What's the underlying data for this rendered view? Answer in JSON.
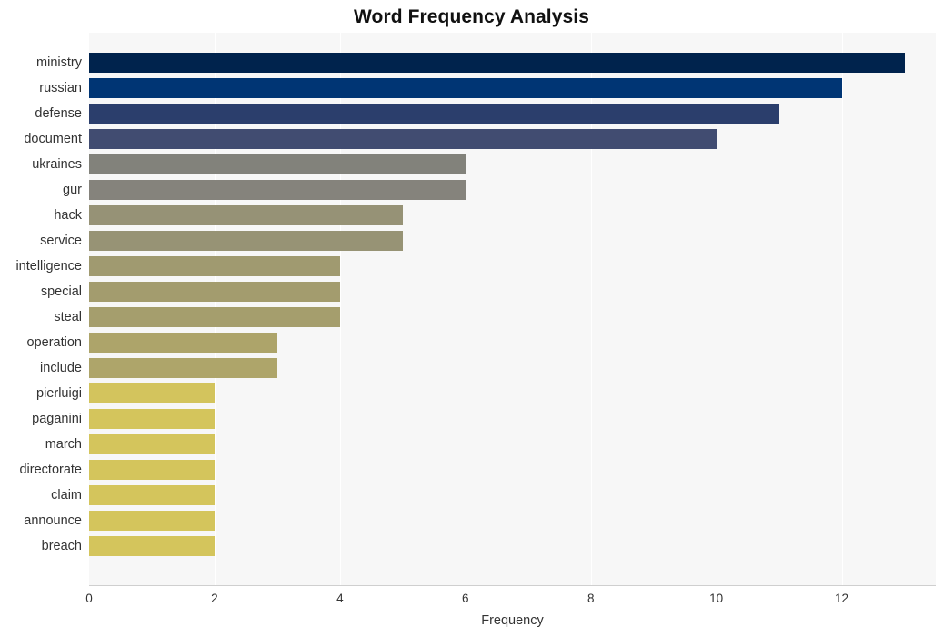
{
  "chart_data": {
    "type": "bar",
    "orientation": "horizontal",
    "title": "Word Frequency Analysis",
    "xlabel": "Frequency",
    "ylabel": "",
    "xlim": [
      0,
      13.5
    ],
    "xticks": [
      "0",
      "2",
      "4",
      "6",
      "8",
      "10",
      "12"
    ],
    "xtick_values": [
      0,
      2,
      4,
      6,
      8,
      10,
      12
    ],
    "grid": true,
    "grid_axis": "x",
    "legend": "none",
    "categories": [
      "ministry",
      "russian",
      "defense",
      "document",
      "ukraines",
      "gur",
      "hack",
      "service",
      "intelligence",
      "special",
      "steal",
      "operation",
      "include",
      "pierluigi",
      "paganini",
      "march",
      "directorate",
      "claim",
      "announce",
      "breach"
    ],
    "values": [
      13,
      12,
      11,
      10,
      6,
      6,
      5,
      5,
      4,
      4,
      4,
      3,
      3,
      2,
      2,
      2,
      2,
      2,
      2,
      2
    ],
    "bar_colors": [
      "#00234d",
      "#003574",
      "#2b3e6c",
      "#414c71",
      "#82827b",
      "#85837c",
      "#969276",
      "#979375",
      "#a09a70",
      "#a39c6e",
      "#a59e6d",
      "#ad a46a",
      "#aea56a",
      "#d3c45d",
      "#d4c55c",
      "#d4c55c",
      "#d4c55c",
      "#d4c55c",
      "#d4c55c",
      "#d4c55c"
    ],
    "plot_background": "#f7f7f7",
    "gridline_color": "#ffffff"
  }
}
